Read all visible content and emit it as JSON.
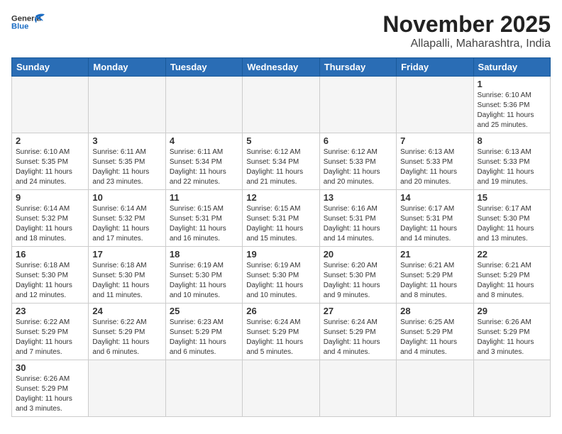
{
  "header": {
    "logo_general": "General",
    "logo_blue": "Blue",
    "title": "November 2025",
    "subtitle": "Allapalli, Maharashtra, India"
  },
  "weekdays": [
    "Sunday",
    "Monday",
    "Tuesday",
    "Wednesday",
    "Thursday",
    "Friday",
    "Saturday"
  ],
  "days": [
    {
      "date": 1,
      "sunrise": "6:10 AM",
      "sunset": "5:36 PM",
      "daylight": "11 hours and 25 minutes."
    },
    {
      "date": 2,
      "sunrise": "6:10 AM",
      "sunset": "5:35 PM",
      "daylight": "11 hours and 24 minutes."
    },
    {
      "date": 3,
      "sunrise": "6:11 AM",
      "sunset": "5:35 PM",
      "daylight": "11 hours and 23 minutes."
    },
    {
      "date": 4,
      "sunrise": "6:11 AM",
      "sunset": "5:34 PM",
      "daylight": "11 hours and 22 minutes."
    },
    {
      "date": 5,
      "sunrise": "6:12 AM",
      "sunset": "5:34 PM",
      "daylight": "11 hours and 21 minutes."
    },
    {
      "date": 6,
      "sunrise": "6:12 AM",
      "sunset": "5:33 PM",
      "daylight": "11 hours and 20 minutes."
    },
    {
      "date": 7,
      "sunrise": "6:13 AM",
      "sunset": "5:33 PM",
      "daylight": "11 hours and 20 minutes."
    },
    {
      "date": 8,
      "sunrise": "6:13 AM",
      "sunset": "5:33 PM",
      "daylight": "11 hours and 19 minutes."
    },
    {
      "date": 9,
      "sunrise": "6:14 AM",
      "sunset": "5:32 PM",
      "daylight": "11 hours and 18 minutes."
    },
    {
      "date": 10,
      "sunrise": "6:14 AM",
      "sunset": "5:32 PM",
      "daylight": "11 hours and 17 minutes."
    },
    {
      "date": 11,
      "sunrise": "6:15 AM",
      "sunset": "5:31 PM",
      "daylight": "11 hours and 16 minutes."
    },
    {
      "date": 12,
      "sunrise": "6:15 AM",
      "sunset": "5:31 PM",
      "daylight": "11 hours and 15 minutes."
    },
    {
      "date": 13,
      "sunrise": "6:16 AM",
      "sunset": "5:31 PM",
      "daylight": "11 hours and 14 minutes."
    },
    {
      "date": 14,
      "sunrise": "6:17 AM",
      "sunset": "5:31 PM",
      "daylight": "11 hours and 14 minutes."
    },
    {
      "date": 15,
      "sunrise": "6:17 AM",
      "sunset": "5:30 PM",
      "daylight": "11 hours and 13 minutes."
    },
    {
      "date": 16,
      "sunrise": "6:18 AM",
      "sunset": "5:30 PM",
      "daylight": "11 hours and 12 minutes."
    },
    {
      "date": 17,
      "sunrise": "6:18 AM",
      "sunset": "5:30 PM",
      "daylight": "11 hours and 11 minutes."
    },
    {
      "date": 18,
      "sunrise": "6:19 AM",
      "sunset": "5:30 PM",
      "daylight": "11 hours and 10 minutes."
    },
    {
      "date": 19,
      "sunrise": "6:19 AM",
      "sunset": "5:30 PM",
      "daylight": "11 hours and 10 minutes."
    },
    {
      "date": 20,
      "sunrise": "6:20 AM",
      "sunset": "5:30 PM",
      "daylight": "11 hours and 9 minutes."
    },
    {
      "date": 21,
      "sunrise": "6:21 AM",
      "sunset": "5:29 PM",
      "daylight": "11 hours and 8 minutes."
    },
    {
      "date": 22,
      "sunrise": "6:21 AM",
      "sunset": "5:29 PM",
      "daylight": "11 hours and 8 minutes."
    },
    {
      "date": 23,
      "sunrise": "6:22 AM",
      "sunset": "5:29 PM",
      "daylight": "11 hours and 7 minutes."
    },
    {
      "date": 24,
      "sunrise": "6:22 AM",
      "sunset": "5:29 PM",
      "daylight": "11 hours and 6 minutes."
    },
    {
      "date": 25,
      "sunrise": "6:23 AM",
      "sunset": "5:29 PM",
      "daylight": "11 hours and 6 minutes."
    },
    {
      "date": 26,
      "sunrise": "6:24 AM",
      "sunset": "5:29 PM",
      "daylight": "11 hours and 5 minutes."
    },
    {
      "date": 27,
      "sunrise": "6:24 AM",
      "sunset": "5:29 PM",
      "daylight": "11 hours and 4 minutes."
    },
    {
      "date": 28,
      "sunrise": "6:25 AM",
      "sunset": "5:29 PM",
      "daylight": "11 hours and 4 minutes."
    },
    {
      "date": 29,
      "sunrise": "6:26 AM",
      "sunset": "5:29 PM",
      "daylight": "11 hours and 3 minutes."
    },
    {
      "date": 30,
      "sunrise": "6:26 AM",
      "sunset": "5:29 PM",
      "daylight": "11 hours and 3 minutes."
    }
  ]
}
